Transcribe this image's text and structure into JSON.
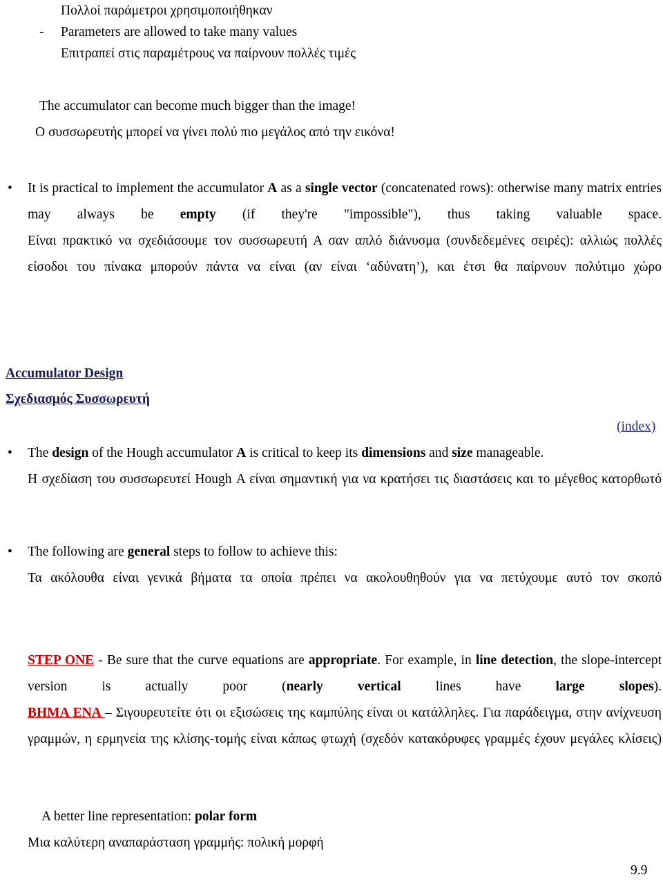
{
  "document": {
    "page_number": "9.9",
    "colors": {
      "text": "#000000",
      "heading_blue": "#19195e",
      "link_blue": "#2b2b8c",
      "step_red": "#cc0000"
    }
  },
  "blocks": {
    "intro": {
      "line_gr_1": "Πολλοί παράμετροι χρησιμοποιήθηκαν",
      "dash_bullet": "-",
      "line_en_1": "Parameters are allowed to take many values",
      "line_gr_2": "Επιτραπεί στις παραμέτρους να παίρνουν πολλές τιμές",
      "line_en_2": "The accumulator can become much bigger than the image!",
      "line_gr_3": "Ο συσσωρευτής μπορεί να γίνει πολύ πιο μεγάλος από την εικόνα!"
    },
    "practical": {
      "bullet": "•",
      "en_part_1": "It is practical to implement the accumulator ",
      "en_bold_a": "A",
      "en_part_2": " as a ",
      "en_bold_single_vector": "single vector",
      "en_part_3": " (concatenated rows): otherwise many matrix entries may always be ",
      "en_bold_empty": "empty",
      "en_part_4": " (if they're \"impossible\"), thus taking valuable space.",
      "gr_text": "Είναι πρακτικό να σχεδιάσουμε τον συσσωρευτή Α σαν απλό διάνυσμα (συνδεδεμένες σειρές): αλλιώς πολλές είσοδοι του πίνακα μπορούν πάντα να είναι (αν είναι ‘αδύνατη’), και έτσι θα παίρνουν πολύτιμο χώρο"
    },
    "accumulator_design": {
      "heading_en": "Accumulator Design",
      "heading_gr": "Σχεδιασμός Συσσωρευτή",
      "index_link": "(index)",
      "bullet": "•",
      "en_part_1": "The ",
      "en_bold_design": "design",
      "en_part_2": " of the Hough accumulator ",
      "en_bold_a": "A",
      "en_part_3": " is critical to keep its ",
      "en_bold_dimensions": "dimensions",
      "en_part_4": " and ",
      "en_bold_size": "size",
      "en_part_5": " manageable.",
      "gr_text": "Η σχεδίαση του συσσωρευτεί Hough Α είναι σημαντική για να κρατήσει τις διαστάσεις και το μέγεθος κατορθωτό"
    },
    "general_steps": {
      "bullet": "•",
      "en_part_1": "The following are ",
      "en_bold_general": "general",
      "en_part_2": " steps to follow to achieve this:",
      "gr_text": "Τα ακόλουθα είναι γενικά βήματα τα οποία πρέπει να ακολουθηθούν για να πετύχουμε αυτό τον σκοπό"
    },
    "step_one": {
      "label_en": "STEP ONE",
      "en_part_1": " - Be sure that the curve equations are ",
      "en_bold_appropriate": "appropriate",
      "en_part_2": ". For example, in ",
      "en_bold_line_detection": "line detection",
      "en_part_3": ", the slope-intercept version is actually poor (",
      "en_bold_nearly_vertical": "nearly vertical",
      "en_part_4": " lines have ",
      "en_bold_large_slopes": "large slopes",
      "en_part_5": ").",
      "label_gr": "ΒΗΜΑ ΕΝΑ ",
      "gr_text": "– Σιγουρευτείτε ότι οι εξισώσεις της καμπύλης είναι οι κατάλληλες.  Για παράδειγμα, στην ανίχνευση γραμμών, η ερμηνεία της κλίσης-τομής είναι κάπως φτωχή (σχεδόν κατακόρυφες γραμμές έχουν μεγάλες κλίσεις)"
    },
    "polar_form": {
      "en_part_1": "A better line representation: ",
      "en_bold_polar_form": "polar form",
      "gr_text": "Μια καλύτερη αναπαράσταση γραμμής: πολική μορφή"
    }
  }
}
